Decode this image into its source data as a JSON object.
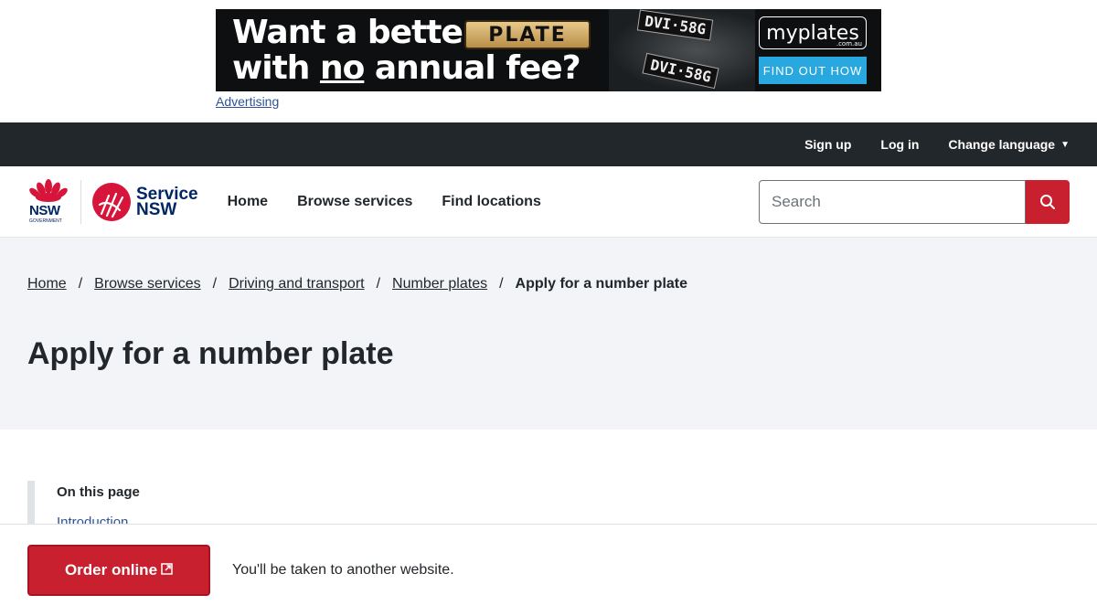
{
  "ad": {
    "headline_1": "Want a better",
    "plate_text": "PLATE",
    "headline_2a": "with ",
    "headline_2b": "no",
    "headline_2c": " annual fee?",
    "car_plate": "DVI·58G",
    "brand": "myplates",
    "brand_sub": ".com.au",
    "cta": "FIND OUT HOW",
    "advertising_label": "Advertising"
  },
  "utility": {
    "sign_up": "Sign up",
    "log_in": "Log in",
    "change_language": "Change language"
  },
  "logo": {
    "nsw": "NSW",
    "government": "GOVERNMENT",
    "service_line1": "Service",
    "service_line2": "NSW"
  },
  "nav": {
    "home": "Home",
    "browse": "Browse services",
    "locations": "Find locations"
  },
  "search": {
    "placeholder": "Search"
  },
  "breadcrumb": {
    "items": [
      "Home",
      "Browse services",
      "Driving and transport",
      "Number plates"
    ],
    "current": "Apply for a number plate",
    "separator": "/"
  },
  "page": {
    "title": "Apply for a number plate"
  },
  "on_this_page": {
    "title": "On this page",
    "first_item": "Introduction"
  },
  "sticky": {
    "button": "Order online",
    "note": "You'll be taken to another website."
  },
  "colors": {
    "primary_red": "#c8202f",
    "navy": "#002664",
    "dark_bar": "#22272b",
    "hero_bg": "#f2f4f7"
  }
}
